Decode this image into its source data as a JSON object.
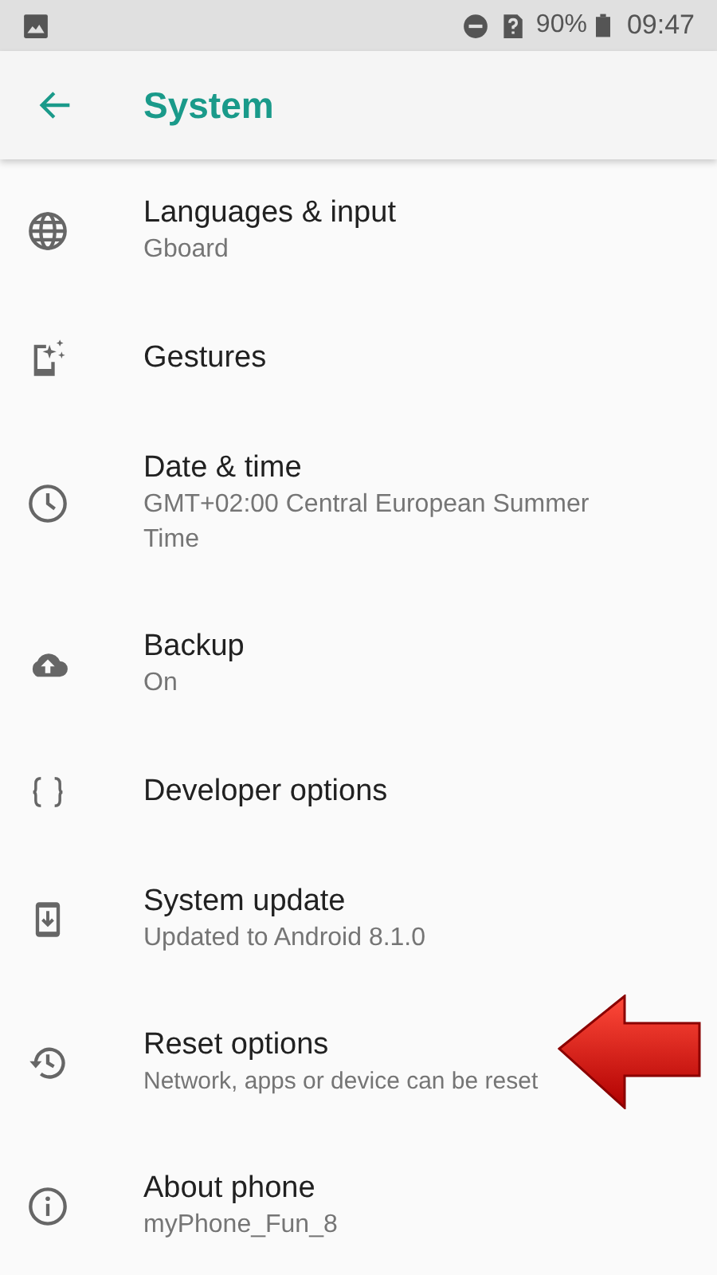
{
  "status_bar": {
    "battery": "90%",
    "time": "09:47"
  },
  "toolbar": {
    "title": "System"
  },
  "items": [
    {
      "kind": "globe",
      "title": "Languages & input",
      "summary": "Gboard"
    },
    {
      "kind": "gestures",
      "title": "Gestures"
    },
    {
      "kind": "clock",
      "title": "Date & time",
      "summary": "GMT+02:00 Central European Summer Time"
    },
    {
      "kind": "cloud",
      "title": "Backup",
      "summary": "On"
    },
    {
      "kind": "braces",
      "title": "Developer options"
    },
    {
      "kind": "update",
      "title": "System update",
      "summary": "Updated to Android 8.1.0"
    },
    {
      "kind": "history",
      "title": "Reset options",
      "summary": "Network, apps or device can be reset",
      "pointer": true
    },
    {
      "kind": "info",
      "title": "About phone",
      "summary": "myPhone_Fun_8"
    }
  ]
}
